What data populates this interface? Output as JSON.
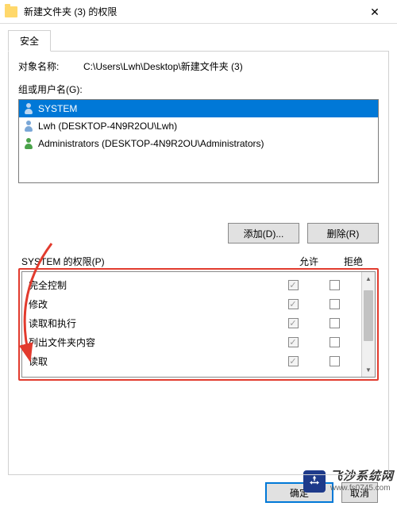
{
  "titlebar": {
    "title": "新建文件夹 (3) 的权限"
  },
  "tabs": {
    "security": "安全"
  },
  "object_name_label": "对象名称:",
  "object_name_value": "C:\\Users\\Lwh\\Desktop\\新建文件夹 (3)",
  "group_users_label": "组或用户名(G):",
  "users": [
    {
      "label": "SYSTEM",
      "selected": true,
      "iconStyle": "green"
    },
    {
      "label": "Lwh (DESKTOP-4N9R2OU\\Lwh)",
      "selected": false,
      "iconStyle": ""
    },
    {
      "label": "Administrators (DESKTOP-4N9R2OU\\Administrators)",
      "selected": false,
      "iconStyle": "green"
    }
  ],
  "buttons": {
    "add": "添加(D)...",
    "remove": "删除(R)"
  },
  "perm_header": {
    "title": "SYSTEM 的权限(P)",
    "allow": "允许",
    "deny": "拒绝"
  },
  "permissions": [
    {
      "name": "完全控制",
      "allow": true,
      "deny": false
    },
    {
      "name": "修改",
      "allow": true,
      "deny": false
    },
    {
      "name": "读取和执行",
      "allow": true,
      "deny": false
    },
    {
      "name": "列出文件夹内容",
      "allow": true,
      "deny": false
    },
    {
      "name": "读取",
      "allow": true,
      "deny": false
    }
  ],
  "dialog_buttons": {
    "ok": "确定",
    "cancel": "取消"
  },
  "watermark": {
    "name": "飞沙系统网",
    "url": "www.fs0745.com"
  }
}
